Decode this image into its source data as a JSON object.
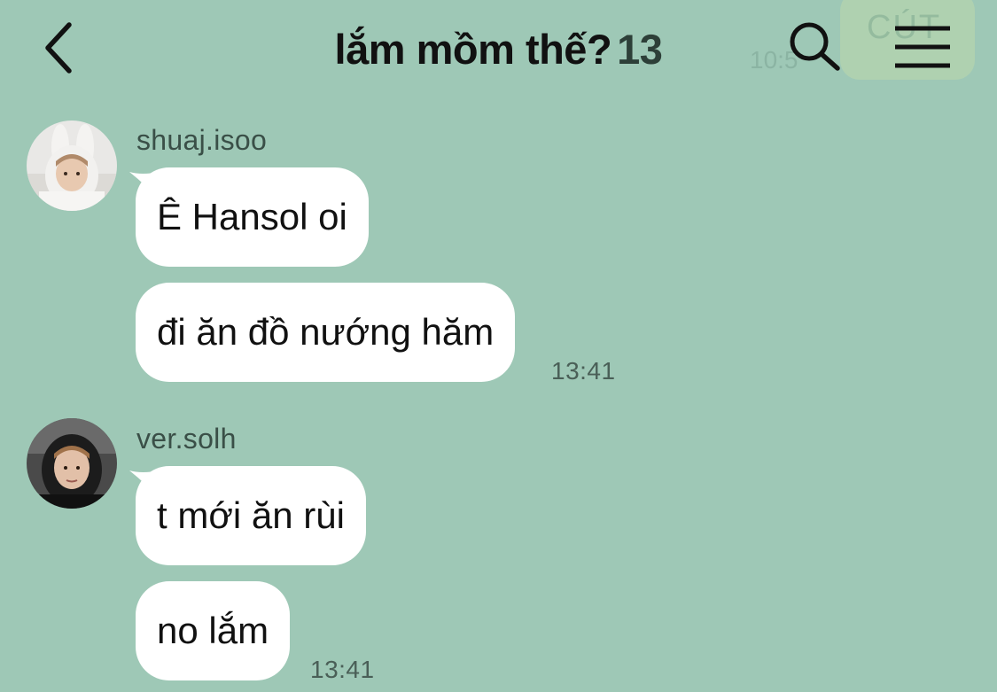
{
  "header": {
    "title": "lắm mồm thế?",
    "member_count": "13",
    "back_icon": "chevron-left-icon",
    "search_icon": "search-icon",
    "menu_icon": "hamburger-menu-icon",
    "ghost_time": "10:5",
    "ghost_bubble_text": "CÚT"
  },
  "messages": [
    {
      "sender": "shuaj.isoo",
      "bubbles": [
        "Ê Hansol oi",
        "đi ăn đồ nướng hăm"
      ],
      "time": "13:41"
    },
    {
      "sender": "ver.solh",
      "bubbles": [
        "t mới ăn rùi",
        "no lắm"
      ],
      "time": "13:41"
    }
  ],
  "colors": {
    "background": "#9ec8b6",
    "bubble": "#ffffff",
    "text": "#111111"
  }
}
